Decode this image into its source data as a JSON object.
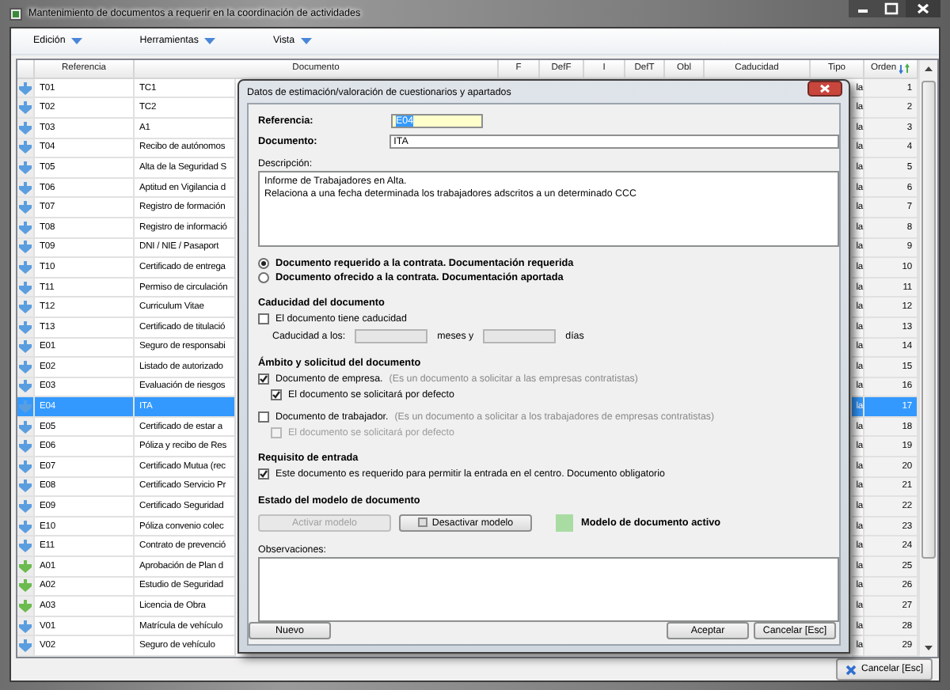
{
  "window": {
    "title": "Mantenimiento de documentos a requerir en la coordinación de actividades"
  },
  "menu": [
    {
      "label": "Edición"
    },
    {
      "label": "Herramientas"
    },
    {
      "label": "Vista"
    }
  ],
  "table": {
    "columns": [
      "Referencia",
      "Documento",
      "F",
      "DefF",
      "I",
      "DefT",
      "Obl",
      "Caducidad",
      "Tipo",
      "Orden"
    ],
    "rows": [
      {
        "reference": "T01",
        "document": "TC1",
        "type": "la",
        "order": "1",
        "color": "#5b9ee0",
        "selected": false
      },
      {
        "reference": "T02",
        "document": "TC2",
        "type": "la",
        "order": "2",
        "color": "#5b9ee0",
        "selected": false
      },
      {
        "reference": "T03",
        "document": "A1",
        "type": "la",
        "order": "3",
        "color": "#5b9ee0",
        "selected": false
      },
      {
        "reference": "T04",
        "document": "Recibo de autónomos",
        "type": "la",
        "order": "4",
        "color": "#5b9ee0",
        "selected": false
      },
      {
        "reference": "T05",
        "document": "Alta de la Seguridad S",
        "type": "la",
        "order": "5",
        "color": "#5b9ee0",
        "selected": false
      },
      {
        "reference": "T06",
        "document": "Aptitud en Vigilancia d",
        "type": "la",
        "order": "6",
        "color": "#5b9ee0",
        "selected": false
      },
      {
        "reference": "T07",
        "document": "Registro de formación",
        "type": "la",
        "order": "7",
        "color": "#5b9ee0",
        "selected": false
      },
      {
        "reference": "T08",
        "document": "Registro de informació",
        "type": "la",
        "order": "8",
        "color": "#5b9ee0",
        "selected": false
      },
      {
        "reference": "T09",
        "document": "DNI / NIE / Pasaport",
        "type": "la",
        "order": "9",
        "color": "#5b9ee0",
        "selected": false
      },
      {
        "reference": "T10",
        "document": "Certificado de entrega",
        "type": "la",
        "order": "10",
        "color": "#5b9ee0",
        "selected": false
      },
      {
        "reference": "T11",
        "document": "Permiso de circulación",
        "type": "la",
        "order": "11",
        "color": "#5b9ee0",
        "selected": false
      },
      {
        "reference": "T12",
        "document": "Curriculum Vitae",
        "type": "la",
        "order": "12",
        "color": "#5b9ee0",
        "selected": false
      },
      {
        "reference": "T13",
        "document": "Certificado de titulació",
        "type": "la",
        "order": "13",
        "color": "#5b9ee0",
        "selected": false
      },
      {
        "reference": "E01",
        "document": "Seguro de responsabi",
        "type": "la",
        "order": "14",
        "color": "#5b9ee0",
        "selected": false
      },
      {
        "reference": "E02",
        "document": "Listado de autorizado",
        "type": "la",
        "order": "15",
        "color": "#5b9ee0",
        "selected": false
      },
      {
        "reference": "E03",
        "document": "Evaluación de riesgos",
        "type": "la",
        "order": "16",
        "color": "#5b9ee0",
        "selected": false
      },
      {
        "reference": "E04",
        "document": "ITA",
        "type": "la",
        "order": "17",
        "color": "#5b9ee0",
        "selected": true
      },
      {
        "reference": "E05",
        "document": "Certificado de estar a",
        "type": "la",
        "order": "18",
        "color": "#5b9ee0",
        "selected": false
      },
      {
        "reference": "E06",
        "document": "Póliza y recibo de Res",
        "type": "la",
        "order": "19",
        "color": "#5b9ee0",
        "selected": false
      },
      {
        "reference": "E07",
        "document": "Certificado Mutua (rec",
        "type": "la",
        "order": "20",
        "color": "#5b9ee0",
        "selected": false
      },
      {
        "reference": "E08",
        "document": "Certificado Servicio Pr",
        "type": "la",
        "order": "21",
        "color": "#5b9ee0",
        "selected": false
      },
      {
        "reference": "E09",
        "document": "Certificado Seguridad",
        "type": "la",
        "order": "22",
        "color": "#5b9ee0",
        "selected": false
      },
      {
        "reference": "E10",
        "document": "Póliza convenio colec",
        "type": "la",
        "order": "23",
        "color": "#5b9ee0",
        "selected": false
      },
      {
        "reference": "E11",
        "document": "Contrato de prevenció",
        "type": "la",
        "order": "24",
        "color": "#5b9ee0",
        "selected": false
      },
      {
        "reference": "A01",
        "document": "Aprobación de Plan d",
        "type": "la",
        "order": "25",
        "color": "#6cbb4e",
        "selected": false
      },
      {
        "reference": "A02",
        "document": "Estudio de Seguridad",
        "type": "la",
        "order": "26",
        "color": "#6cbb4e",
        "selected": false
      },
      {
        "reference": "A03",
        "document": "Licencia de Obra",
        "type": "la",
        "order": "27",
        "color": "#6cbb4e",
        "selected": false
      },
      {
        "reference": "V01",
        "document": "Matrícula de vehículo",
        "type": "la",
        "order": "28",
        "color": "#5b9ee0",
        "selected": false
      },
      {
        "reference": "V02",
        "document": "Seguro de vehículo",
        "type": "la",
        "order": "29",
        "color": "#5b9ee0",
        "selected": false
      }
    ]
  },
  "status_bar": {
    "button": "Cancelar [Esc]"
  },
  "dialog": {
    "title": "Datos de estimación/valoración de cuestionarios y apartados",
    "reference": {
      "label": "Referencia:",
      "value": "E04",
      "value_selected": true
    },
    "document": {
      "label": "Documento:",
      "value": "ITA"
    },
    "description": {
      "label": "Descripción:",
      "lines": [
        "Informe de Trabajadores en Alta.",
        "Relaciona a una fecha determinada los trabajadores adscritos a un determinado CCC"
      ]
    },
    "radios": [
      {
        "label": "Documento requerido a la contrata. Documentación requerida",
        "selected": true
      },
      {
        "label": "Documento ofrecido a la contrata. Documentación aportada",
        "selected": false
      }
    ],
    "expiry": {
      "heading": "Caducidad del documento",
      "checkbox": {
        "label": "El documento tiene caducidad",
        "checked": false
      },
      "label_before": "Caducidad a los:",
      "label_middle": "meses y",
      "label_after": "días"
    },
    "scope": {
      "heading": "Ámbito y solicitud del documento",
      "options": [
        {
          "label": "Documento de empresa.",
          "note": "(Es un documento a solicitar a las empresas contratistas)",
          "checked": true,
          "sub": {
            "label": "El documento se solicitará por defecto",
            "checked": true,
            "disabled": false
          }
        },
        {
          "label": "Documento de trabajador.",
          "note": "(Es un documento a solicitar a los trabajadores de empresas contratistas)",
          "checked": false,
          "sub": {
            "label": "El documento se solicitará por defecto",
            "checked": false,
            "disabled": true
          }
        }
      ]
    },
    "entry": {
      "heading": "Requisito de entrada",
      "checkbox": {
        "label": "Este documento es requerido para permitir la entrada en el centro. Documento obligatorio",
        "checked": true
      }
    },
    "model_state": {
      "heading": "Estado del modelo de documento",
      "buttons": [
        {
          "label": "Activar modelo",
          "disabled": true
        },
        {
          "label": "Desactivar modelo",
          "disabled": false
        }
      ],
      "indicator": "Modelo de documento activo"
    },
    "observations": {
      "label": "Observaciones:"
    },
    "footer": {
      "left_buttons": [
        "Nuevo"
      ],
      "right_buttons": [
        "Aceptar",
        "Cancelar [Esc]"
      ]
    }
  }
}
